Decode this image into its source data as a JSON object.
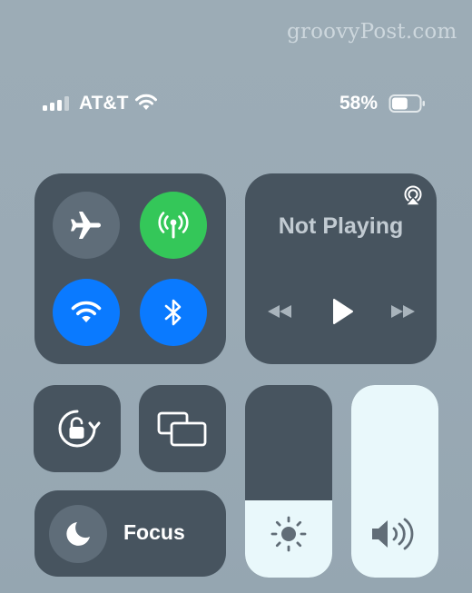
{
  "watermark": "groovyPost.com",
  "status_bar": {
    "carrier": "AT&T",
    "battery_percent": "58%",
    "battery_level": 0.58,
    "signal_bars_filled": 3,
    "signal_bars_total": 4
  },
  "connectivity": {
    "airplane_mode": {
      "icon": "airplane-icon",
      "state": "off"
    },
    "cellular_data": {
      "icon": "antenna-icon",
      "state": "on",
      "color": "#34c759"
    },
    "wifi": {
      "icon": "wifi-icon",
      "state": "on",
      "color": "#0a7aff"
    },
    "bluetooth": {
      "icon": "bluetooth-icon",
      "state": "on",
      "color": "#0a7aff"
    }
  },
  "now_playing": {
    "title": "Not Playing",
    "airplay_icon": "airplay-icon",
    "controls": [
      "rewind-icon",
      "play-icon",
      "fast-forward-icon"
    ]
  },
  "orientation_lock": {
    "icon": "rotation-lock-icon"
  },
  "screen_mirroring": {
    "icon": "screen-mirroring-icon"
  },
  "focus": {
    "label": "Focus",
    "icon": "moon-icon"
  },
  "brightness": {
    "icon": "sun-icon",
    "level": 0.4
  },
  "volume": {
    "icon": "speaker-icon",
    "level": 1.0
  }
}
